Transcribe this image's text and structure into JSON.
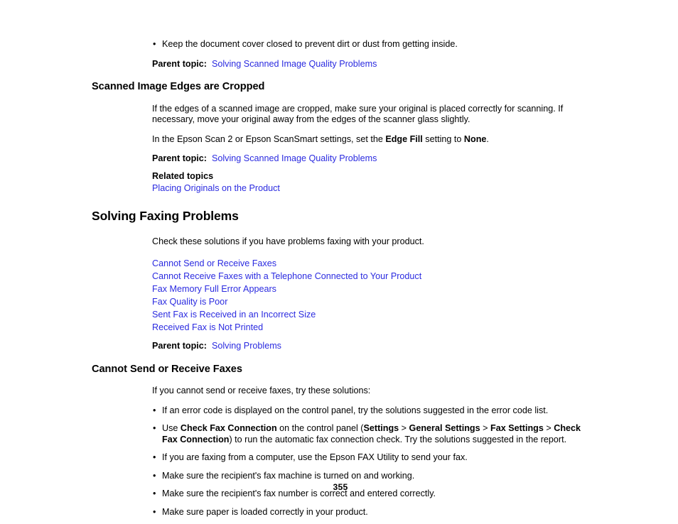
{
  "document": {
    "page_number": "355",
    "link_color": "#2b2be0",
    "text_color": "#000000",
    "background_color": "#ffffff"
  },
  "labels": {
    "parent_topic": "Parent topic:",
    "related_topics": "Related topics",
    "bullet_glyph": "•"
  },
  "top_section": {
    "bullets": [
      "Keep the document cover closed to prevent dirt or dust from getting inside."
    ],
    "parent_topic_link": "Solving Scanned Image Quality Problems"
  },
  "section_cropped": {
    "heading": "Scanned Image Edges are Cropped",
    "paragraph_1": "If the edges of a scanned image are cropped, make sure your original is placed correctly for scanning. If necessary, move your original away from the edges of the scanner glass slightly.",
    "paragraph_2": {
      "part_1": "In the Epson Scan 2 or Epson ScanSmart settings, set the ",
      "bold_1": "Edge Fill",
      "part_2": " setting to ",
      "bold_2": "None",
      "part_3": "."
    },
    "parent_topic_link": "Solving Scanned Image Quality Problems",
    "related_topics_link": "Placing Originals on the Product"
  },
  "section_faxing": {
    "heading": "Solving Faxing Problems",
    "intro": "Check these solutions if you have problems faxing with your product.",
    "links": [
      "Cannot Send or Receive Faxes",
      "Cannot Receive Faxes with a Telephone Connected to Your Product",
      "Fax Memory Full Error Appears",
      "Fax Quality is Poor",
      "Sent Fax is Received in an Incorrect Size",
      "Received Fax is Not Printed"
    ],
    "parent_topic_link": "Solving Problems"
  },
  "section_cannot_send": {
    "heading": "Cannot Send or Receive Faxes",
    "intro": "If you cannot send or receive faxes, try these solutions:",
    "bullet_1": "If an error code is displayed on the control panel, try the solutions suggested in the error code list.",
    "bullet_2": {
      "part_1": "Use ",
      "bold_1": "Check Fax Connection",
      "part_2": " on the control panel (",
      "bold_2": "Settings",
      "part_3": " > ",
      "bold_3": "General Settings",
      "part_4": " > ",
      "bold_4": "Fax Settings",
      "part_5": " > ",
      "bold_5": "Check Fax Connection",
      "part_6": ") to run the automatic fax connection check. Try the solutions suggested in the report."
    },
    "bullet_3": "If you are faxing from a computer, use the Epson FAX Utility to send your fax.",
    "bullet_4": "Make sure the recipient's fax machine is turned on and working.",
    "bullet_5": "Make sure the recipient's fax number is correct and entered correctly.",
    "bullet_6": "Make sure paper is loaded correctly in your product."
  }
}
